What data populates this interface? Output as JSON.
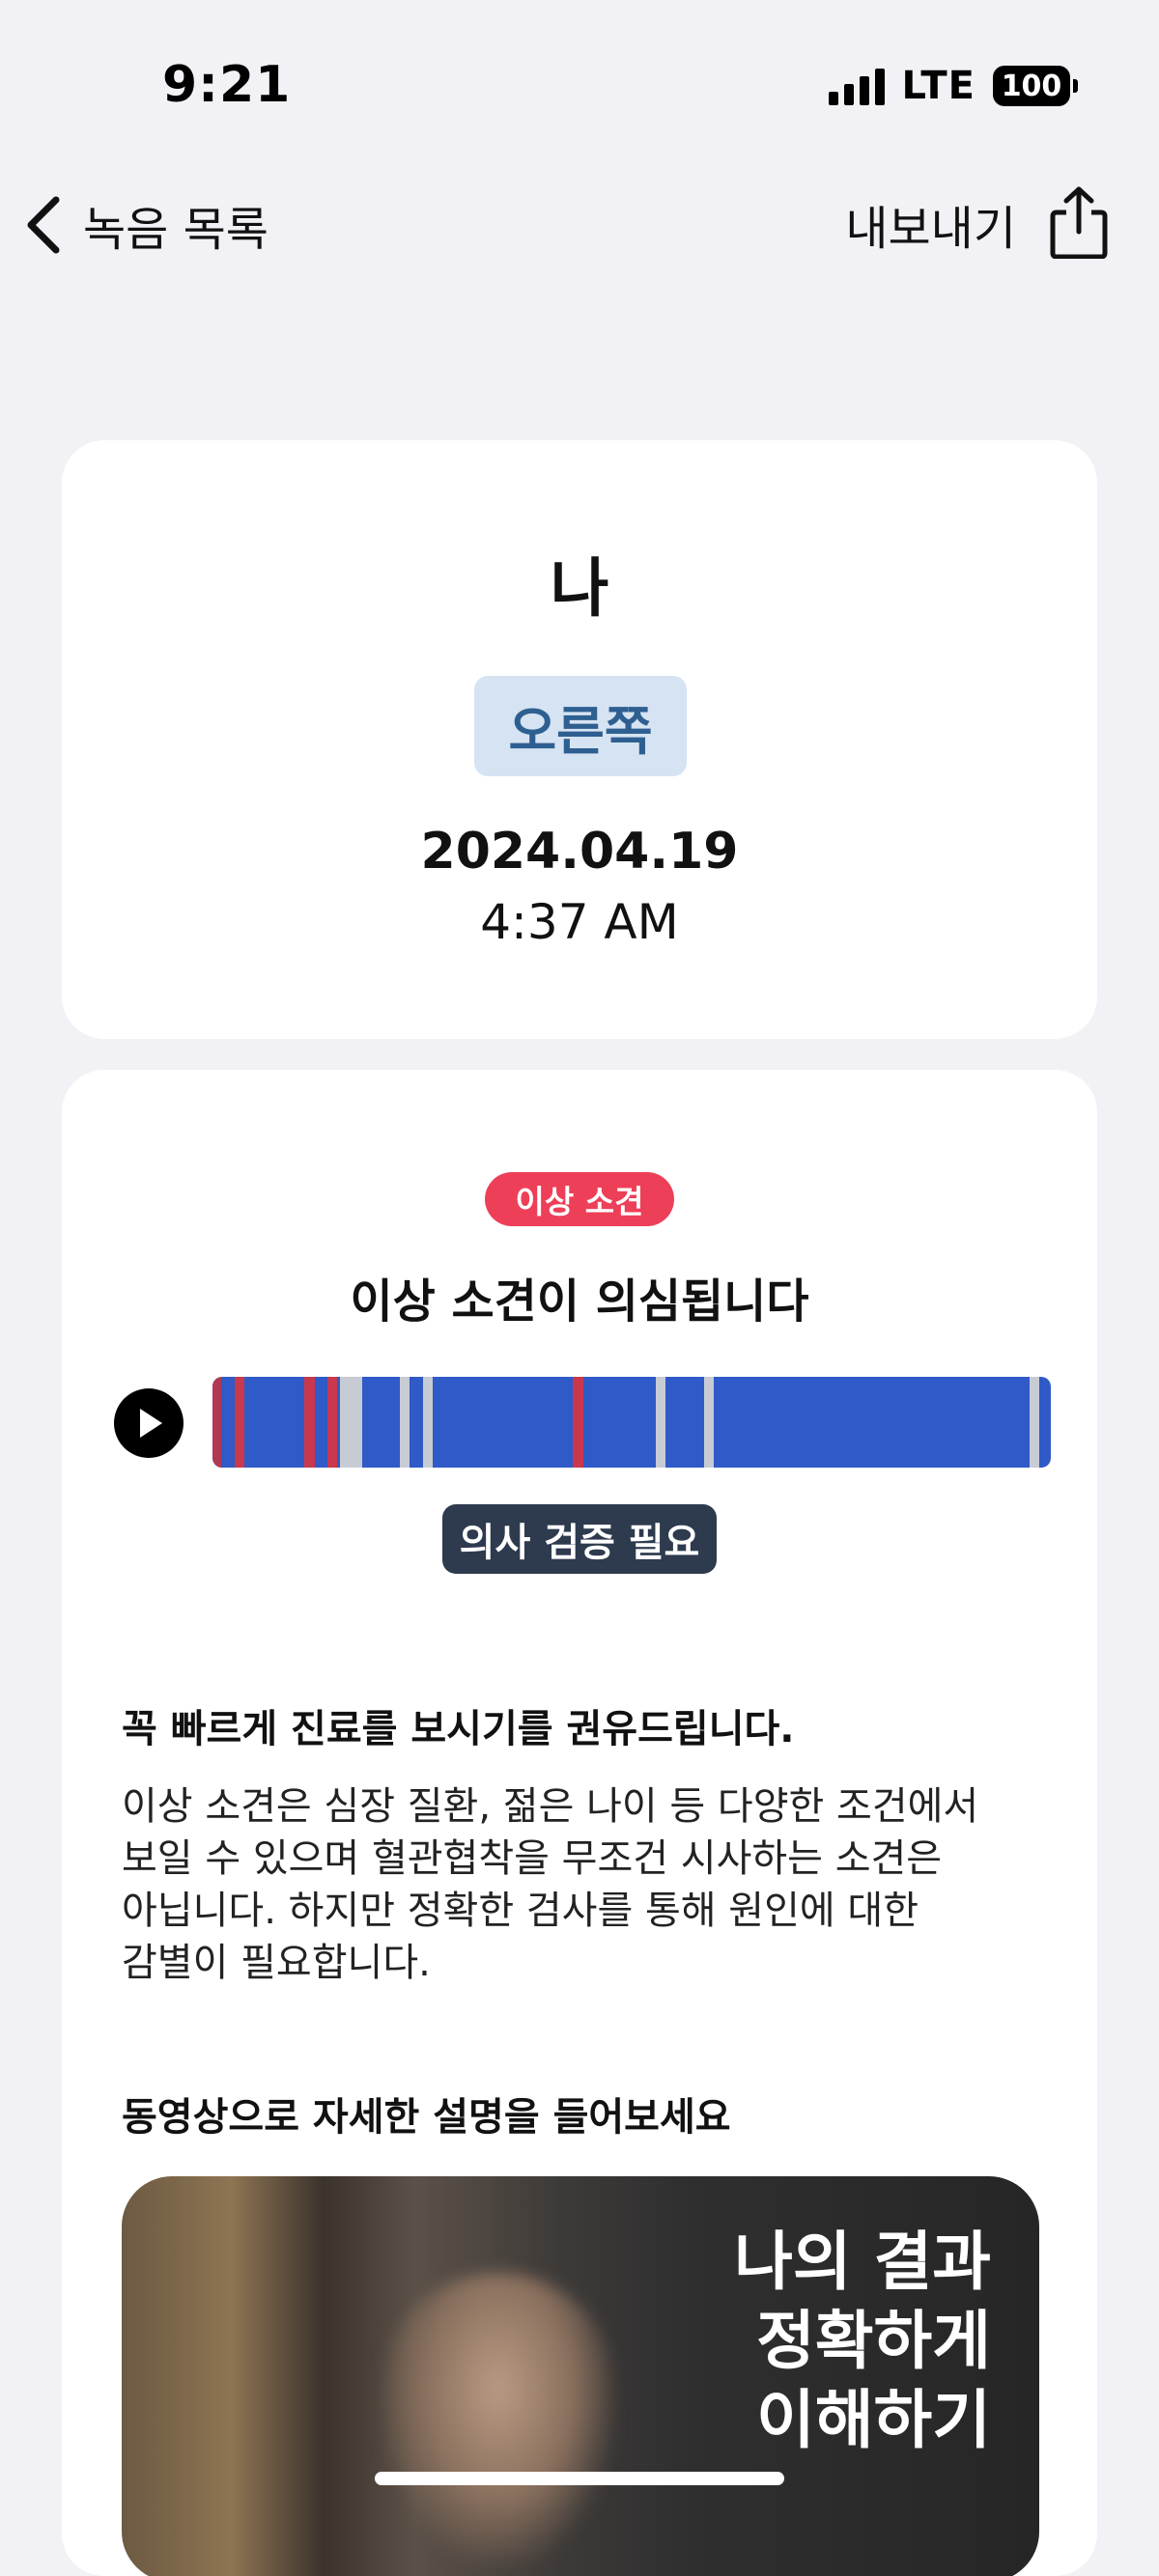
{
  "status_bar": {
    "time": "9:21",
    "network": "LTE",
    "battery": "100"
  },
  "nav": {
    "back_label": "녹음 목록",
    "export_label": "내보내기"
  },
  "recording": {
    "name": "나",
    "side": "오른쪽",
    "date": "2024.04.19",
    "time": "4:37 AM"
  },
  "result": {
    "badge": "이상 소견",
    "title": "이상 소견이 의심됩니다",
    "verify_badge": "의사 검증 필요",
    "advice_title": "꼭 빠르게 진료를 보시기를 권유드립니다.",
    "advice_lines": [
      "이상 소견은 심장 질환, 젊은 나이 등 다양한 조건에서",
      "보일 수 있으며 혈관협착을 무조건 시사하는 소견은",
      "아닙니다. 하지만 정확한 검사를 통해 원인에 대한",
      "감별이 필요합니다."
    ],
    "video_section_title": "동영상으로 자세한 설명을 들어보세요",
    "video_caption_lines": [
      "나의 결과",
      "정확하게",
      "이해하기"
    ]
  },
  "waveform": {
    "base_color": "#2f5ac7",
    "marks": [
      {
        "pos": 0.0,
        "width": 0.01,
        "color": "#b03a54"
      },
      {
        "pos": 0.027,
        "width": 0.011,
        "color": "#c9384d"
      },
      {
        "pos": 0.11,
        "width": 0.013,
        "color": "#c9384d"
      },
      {
        "pos": 0.137,
        "width": 0.011,
        "color": "#c9384d"
      },
      {
        "pos": 0.152,
        "width": 0.027,
        "color": "#c7cbd4"
      },
      {
        "pos": 0.223,
        "width": 0.011,
        "color": "#c7cbd4"
      },
      {
        "pos": 0.251,
        "width": 0.011,
        "color": "#c7cbd4"
      },
      {
        "pos": 0.43,
        "width": 0.013,
        "color": "#c9384d"
      },
      {
        "pos": 0.529,
        "width": 0.011,
        "color": "#c7cbd4"
      },
      {
        "pos": 0.586,
        "width": 0.011,
        "color": "#c7cbd4"
      },
      {
        "pos": 0.975,
        "width": 0.011,
        "color": "#c7cbd4"
      }
    ]
  },
  "colors": {
    "background": "#f1f1f6",
    "card": "#ffffff",
    "abnormal": "#ee3f58",
    "side_badge_bg": "#d6e3f2",
    "side_badge_text": "#2e5f91",
    "verify_bg": "#2e3a4e"
  },
  "icons": {
    "back": "chevron-left-icon",
    "export": "share-icon",
    "play": "play-icon"
  }
}
